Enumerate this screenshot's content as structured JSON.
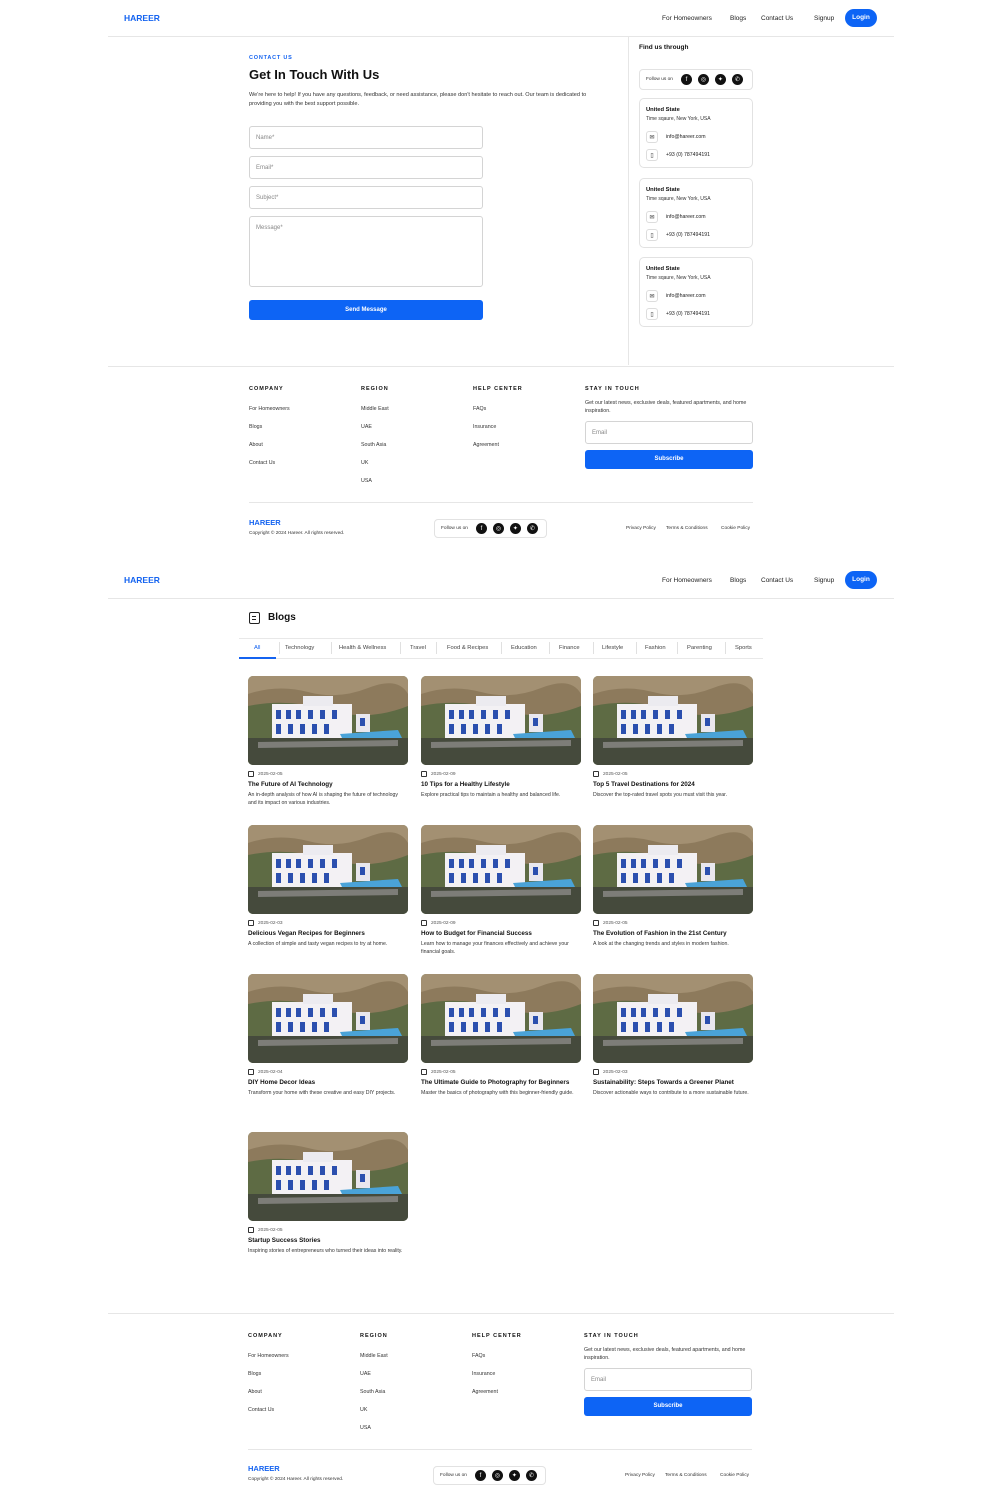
{
  "brand": "HAREER",
  "nav": {
    "items": [
      "For Homeowners",
      "Blogs",
      "Contact Us",
      "Signup"
    ],
    "login": "Login"
  },
  "contact": {
    "eyebrow": "CONTACT US",
    "title": "Get In Touch With Us",
    "intro": "We're here to help! If you have any questions, feedback, or need assistance, please don't hesitate to reach out. Our team is dedicated to providing you with the best support possible.",
    "fields": {
      "name": "Name*",
      "email": "Email*",
      "subject": "Subject*",
      "message": "Message*"
    },
    "send": "Send Message"
  },
  "sidebar": {
    "title": "Find us through",
    "follow": "Follow us on",
    "offices": [
      {
        "country": "United State",
        "address": "Time sqaure, New York, USA",
        "email": "info@hareer.com",
        "phone": "+93 (0) 787494191"
      },
      {
        "country": "United State",
        "address": "Time sqaure, New York, USA",
        "email": "info@hareer.com",
        "phone": "+93 (0) 787494191"
      },
      {
        "country": "United State",
        "address": "Time sqaure, New York, USA",
        "email": "info@hareer.com",
        "phone": "+93 (0) 787494191"
      }
    ]
  },
  "footer": {
    "company": {
      "title": "COMPANY",
      "links": [
        "For Homeowners",
        "Blogs",
        "About",
        "Contact Us"
      ]
    },
    "region": {
      "title": "REGION",
      "links": [
        "Middle East",
        "UAE",
        "South Asia",
        "UK",
        "USA"
      ]
    },
    "help": {
      "title": "HELP CENTER",
      "links": [
        "FAQs",
        "Insurance",
        "Agreement"
      ]
    },
    "stay": {
      "title": "STAY IN TOUCH",
      "text": "Get our latest news, exclusive deals, featured apartments, and home inspiration.",
      "email_placeholder": "Email",
      "subscribe": "Subscribe"
    },
    "copyright": "Copyright © 2024 Hareer. All rights reserved.",
    "follow": "Follow us on",
    "legal": [
      "Privacy Policy",
      "Terms & Conditions",
      "Cookie Policy"
    ]
  },
  "blogs": {
    "title": "Blogs",
    "tabs": [
      "All",
      "Technology",
      "Health & Wellness",
      "Travel",
      "Food & Recipes",
      "Education",
      "Finance",
      "Lifestyle",
      "Fashion",
      "Parenting",
      "Sports"
    ],
    "active_tab": 0,
    "posts": [
      {
        "date": "2025-02-05",
        "title": "The Future of AI Technology",
        "desc": "An in-depth analysis of how AI is shaping the future of technology and its impact on various industries."
      },
      {
        "date": "2025-02-09",
        "title": "10 Tips for a Healthy Lifestyle",
        "desc": "Explore practical tips to maintain a healthy and balanced life."
      },
      {
        "date": "2025-02-05",
        "title": "Top 5 Travel Destinations for 2024",
        "desc": "Discover the top-rated travel spots you must visit this year."
      },
      {
        "date": "2025-02-03",
        "title": "Delicious Vegan Recipes for Beginners",
        "desc": "A collection of simple and tasty vegan recipes to try at home."
      },
      {
        "date": "2025-02-09",
        "title": "How to Budget for Financial Success",
        "desc": "Learn how to manage your finances effectively and achieve your financial goals."
      },
      {
        "date": "2025-02-05",
        "title": "The Evolution of Fashion in the 21st Century",
        "desc": "A look at the changing trends and styles in modern fashion."
      },
      {
        "date": "2025-02-04",
        "title": "DIY Home Decor Ideas",
        "desc": "Transform your home with these creative and easy DIY projects."
      },
      {
        "date": "2025-02-05",
        "title": "The Ultimate Guide to Photography for Beginners",
        "desc": "Master the basics of photography with this beginner-friendly guide."
      },
      {
        "date": "2025-02-03",
        "title": "Sustainability: Steps Towards a Greener Planet",
        "desc": "Discover actionable ways to contribute to a more sustainable future."
      },
      {
        "date": "2025-02-05",
        "title": "Startup Success Stories",
        "desc": "Inspiring stories of entrepreneurs who turned their ideas into reality."
      }
    ]
  },
  "colors": {
    "accent": "#0d64f5",
    "brand": "#1463f0"
  }
}
